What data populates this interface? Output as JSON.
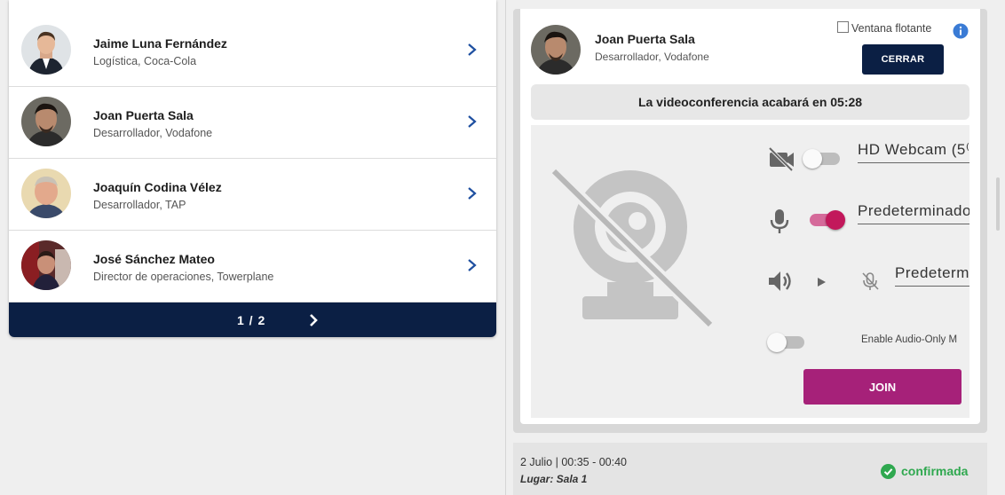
{
  "contacts": [
    {
      "name": "Jaime Luna Fernández",
      "role": "Logística, Coca-Cola"
    },
    {
      "name": "Joan Puerta Sala",
      "role": "Desarrollador, Vodafone"
    },
    {
      "name": "Joaquín Codina Vélez",
      "role": "Desarrollador, TAP"
    },
    {
      "name": "José Sánchez Mateo",
      "role": "Director de operaciones, Towerplane"
    }
  ],
  "pager": {
    "label": "1 / 2"
  },
  "host": {
    "name": "Joan Puerta Sala",
    "role": "Desarrollador, Vodafone"
  },
  "floating_window": {
    "label": "Ventana flotante",
    "checked": false
  },
  "close_button": "CERRAR",
  "timer_text": "La videoconferencia acabará en 05:28",
  "devices": {
    "camera": {
      "label": "HD Webcam (5⁽",
      "enabled": false
    },
    "microphone": {
      "label": "Predeterminado",
      "enabled": true
    },
    "speaker": {
      "label": "Predeterm"
    },
    "audio_only": {
      "label": "Enable Audio-Only M",
      "enabled": false
    }
  },
  "join_button": "JOIN",
  "meeting": {
    "time": "2 Julio | 00:35 - 00:40",
    "place": "Lugar: Sala 1",
    "status": "confirmada"
  },
  "colors": {
    "navy": "#0b1f44",
    "magenta": "#a62179",
    "toggle_on": "#c2185b",
    "confirmed": "#2fa84f",
    "info": "#3a7bd5"
  },
  "icons": [
    "chevron-right-icon",
    "info-icon",
    "camera-off-icon",
    "microphone-icon",
    "speaker-icon",
    "play-icon",
    "mic-off-icon",
    "check-circle-icon",
    "webcam-off-illustration"
  ]
}
